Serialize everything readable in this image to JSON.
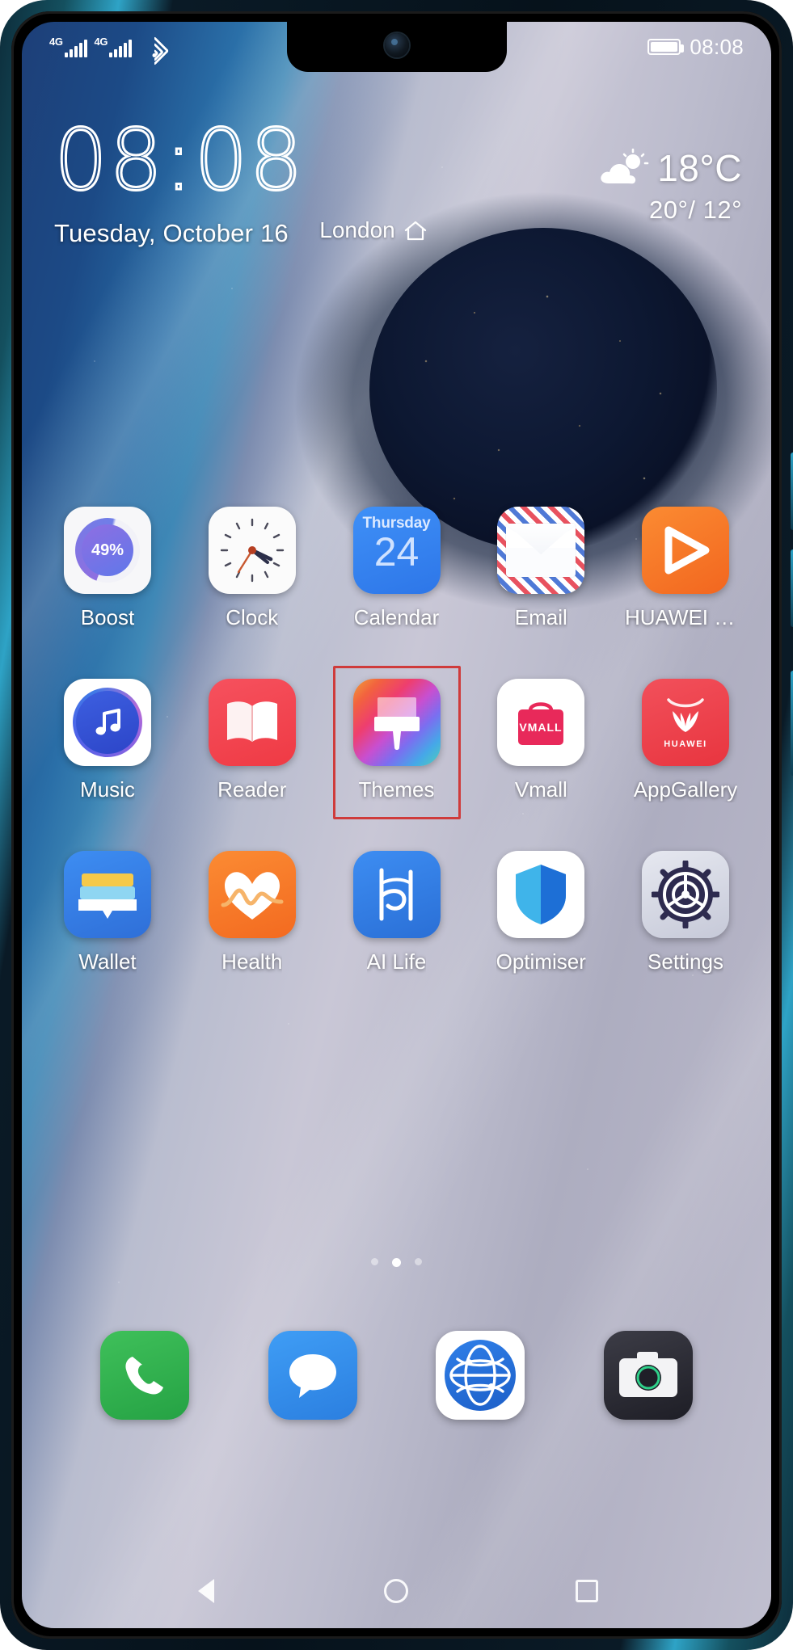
{
  "device": {
    "label": "huawei-phone-home-screen"
  },
  "status_bar": {
    "sim1_network": "4G",
    "sim2_network": "4G",
    "wifi_icon": "wifi-icon",
    "battery_icon": "battery-icon",
    "time": "08:08"
  },
  "widget": {
    "clock_time": "08:08",
    "city": "London",
    "home_icon": "home-icon",
    "date": "Tuesday, October 16",
    "weather": {
      "icon": "partly-cloudy-icon",
      "temperature": "18°C",
      "range": "20°/ 12°"
    }
  },
  "apps": {
    "row1": [
      {
        "label": "Boost",
        "icon": "boost-icon",
        "badge": "49%"
      },
      {
        "label": "Clock",
        "icon": "clock-icon"
      },
      {
        "label": "Calendar",
        "icon": "calendar-icon",
        "day_of_week": "Thursday",
        "day": "24"
      },
      {
        "label": "Email",
        "icon": "email-icon"
      },
      {
        "label": "HUAWEI Vi...",
        "icon": "huawei-video-icon"
      }
    ],
    "row2": [
      {
        "label": "Music",
        "icon": "music-icon"
      },
      {
        "label": "Reader",
        "icon": "reader-icon"
      },
      {
        "label": "Themes",
        "icon": "themes-icon",
        "highlighted": true
      },
      {
        "label": "Vmall",
        "icon": "vmall-icon",
        "badge": "VMALL"
      },
      {
        "label": "AppGallery",
        "icon": "appgallery-icon",
        "badge": "HUAWEI"
      }
    ],
    "row3": [
      {
        "label": "Wallet",
        "icon": "wallet-icon"
      },
      {
        "label": "Health",
        "icon": "health-icon"
      },
      {
        "label": "AI Life",
        "icon": "ai-life-icon"
      },
      {
        "label": "Optimiser",
        "icon": "optimiser-icon"
      },
      {
        "label": "Settings",
        "icon": "settings-icon"
      }
    ]
  },
  "page_indicator": {
    "total": 3,
    "active_index": 1
  },
  "dock": [
    {
      "label": "phone",
      "icon": "phone-icon"
    },
    {
      "label": "messages",
      "icon": "messages-icon"
    },
    {
      "label": "browser",
      "icon": "browser-globe-icon"
    },
    {
      "label": "camera",
      "icon": "camera-icon"
    }
  ],
  "nav_bar": [
    {
      "label": "back",
      "icon": "back-triangle-icon"
    },
    {
      "label": "home",
      "icon": "home-circle-icon"
    },
    {
      "label": "recents",
      "icon": "recents-square-icon"
    }
  ],
  "highlight": {
    "target": "Themes",
    "color": "#cf3b3b"
  }
}
